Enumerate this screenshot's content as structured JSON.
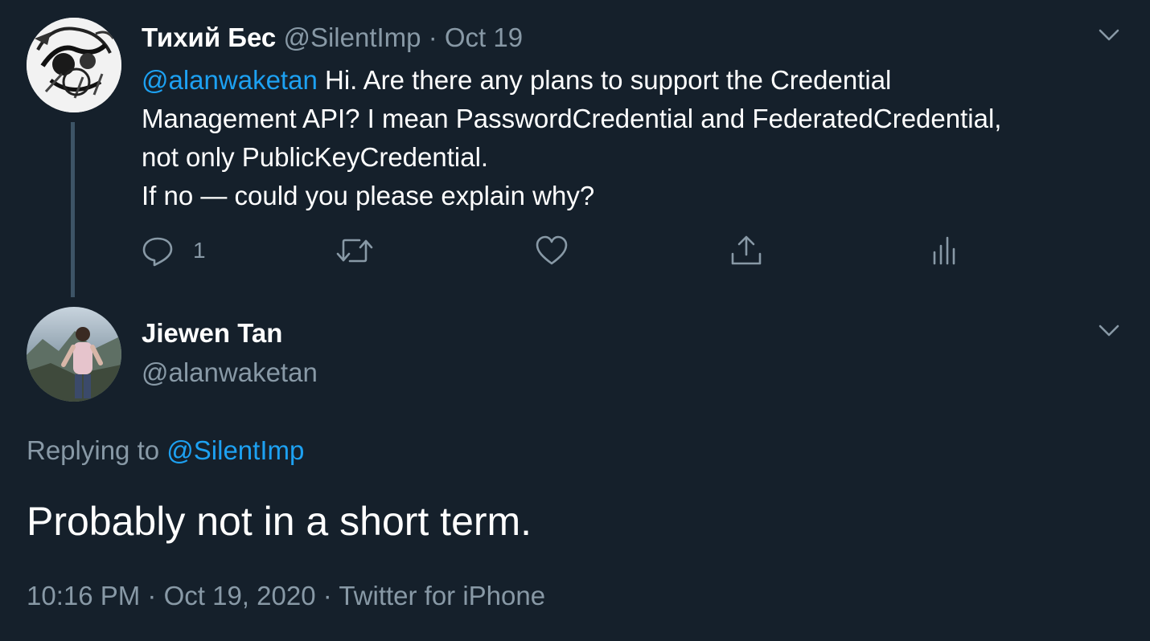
{
  "parent_tweet": {
    "author_name": "Тихий Бес",
    "author_handle": "@SilentImp",
    "separator": "·",
    "date": "Oct 19",
    "mention": "@alanwaketan",
    "text_line1": " Hi. Are there any plans to support the Credential",
    "text_line2": "Management API? I mean PasswordCredential and FederatedCredential,",
    "text_line3": "not only PublicKeyCredential.",
    "text_line4": "If no — could you please explain why?",
    "reply_count": "1",
    "icons": {
      "menu": "chevron-down-icon",
      "reply": "reply-icon",
      "retweet": "retweet-icon",
      "like": "heart-icon",
      "share": "share-icon",
      "analytics": "analytics-icon"
    }
  },
  "reply_tweet": {
    "author_name": "Jiewen Tan",
    "author_handle": "@alanwaketan",
    "replying_prefix": "Replying to ",
    "replying_to": "@SilentImp",
    "text": "Probably not in a short term.",
    "time": "10:16 PM",
    "separator": "·",
    "date": "Oct 19, 2020",
    "source": "Twitter for iPhone"
  },
  "colors": {
    "background": "#15202b",
    "text_primary": "#ffffff",
    "text_secondary": "#8899a6",
    "accent": "#1da1f2",
    "thread_line": "#3d5466"
  }
}
